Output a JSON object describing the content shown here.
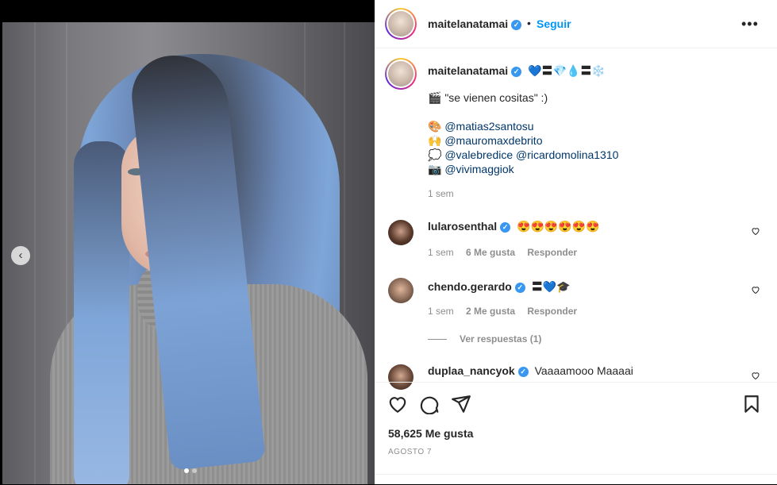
{
  "post": {
    "username": "maitelanatamai",
    "follow_label": "Seguir",
    "separator": "•",
    "more_label": "•••",
    "image_nav_prev": "‹"
  },
  "caption": {
    "username": "maitelanatamai",
    "title_emojis": "💙〓💎💧〓❄️",
    "line1_emoji": "🎬",
    "line1_text": "\"se vienen cositas\" :)",
    "credits": [
      {
        "emoji": "🎨",
        "mentions": "@matias2santosu"
      },
      {
        "emoji": "🙌",
        "mentions": "@mauromaxdebrito"
      },
      {
        "emoji": "💭",
        "mentions": "@valebredice @ricardomolina1310"
      },
      {
        "emoji": "📷",
        "mentions": "@vivimaggiok"
      }
    ],
    "time": "1 sem"
  },
  "comments": [
    {
      "username": "lularosenthal",
      "text": "😍😍😍😍😍😍",
      "time": "1 sem",
      "likes": "6 Me gusta",
      "reply": "Responder"
    },
    {
      "username": "chendo.gerardo",
      "text": "〓💙🎓",
      "time": "1 sem",
      "likes": "2 Me gusta",
      "reply": "Responder"
    },
    {
      "username": "duplaa_nancyok",
      "text": "Vaaaamooo Maaaai"
    }
  ],
  "view_replies": "Ver respuestas (1)",
  "footer": {
    "likes": "58,625 Me gusta",
    "date": "AGOSTO 7"
  },
  "colors": {
    "link": "#0095f6",
    "verified": "#3897f0",
    "mention": "#00376b"
  }
}
